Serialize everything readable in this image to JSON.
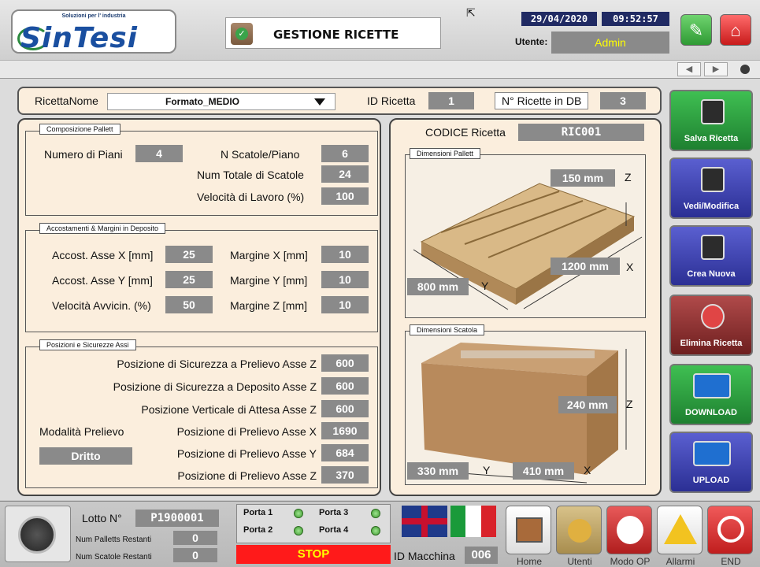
{
  "header": {
    "logo_tagline": "Soluzioni per l' industria",
    "logo_text": "SinTesi",
    "title": "GESTIONE RICETTE",
    "date": "29/04/2020",
    "time": "09:52:57",
    "user_label": "Utente:",
    "user_value": "Admin"
  },
  "navbar": {
    "prev": "◀",
    "next": "▶"
  },
  "recipe_bar": {
    "name_label": "RicettaNome",
    "name_value": "Formato_MEDIO",
    "id_label": "ID Ricetta",
    "id_value": "1",
    "count_label": "N° Ricette in DB",
    "count_value": "3"
  },
  "composition": {
    "title": "Composizione Pallett",
    "floors_label": "Numero di Piani",
    "floors_value": "4",
    "boxes_per_floor_label": "N Scatole/Piano",
    "boxes_per_floor_value": "6",
    "total_boxes_label": "Num Totale di Scatole",
    "total_boxes_value": "24",
    "speed_label": "Velocità di Lavoro (%)",
    "speed_value": "100"
  },
  "approach": {
    "title": "Accostamenti & Margini in Deposito",
    "ax_label": "Accost. Asse X [mm]",
    "ax_value": "25",
    "ay_label": "Accost. Asse Y [mm]",
    "ay_value": "25",
    "av_label": "Velocità Avvicin. (%)",
    "av_value": "50",
    "mx_label": "Margine X [mm]",
    "mx_value": "10",
    "my_label": "Margine Y [mm]",
    "my_value": "10",
    "mz_label": "Margine Z [mm]",
    "mz_value": "10"
  },
  "positions": {
    "title": "Posizioni e Sicurezze Assi",
    "mode_label": "Modalità Prelievo",
    "mode_value": "Dritto",
    "rows": [
      {
        "label": "Posizione di Sicurezza a Prelievo Asse Z",
        "value": "600"
      },
      {
        "label": "Posizione di Sicurezza a Deposito Asse Z",
        "value": "600"
      },
      {
        "label": "Posizione Verticale di Attesa Asse Z",
        "value": "600"
      },
      {
        "label": "Posizione di Prelievo Asse X",
        "value": "1690"
      },
      {
        "label": "Posizione di Prelievo Asse Y",
        "value": "684"
      },
      {
        "label": "Posizione di Prelievo Asse Z",
        "value": "370"
      }
    ]
  },
  "right_panel": {
    "code_label": "CODICE Ricetta",
    "code_value": "RIC001",
    "pallet_title": "Dimensioni Pallett",
    "pallet_z": "150 mm",
    "pallet_z_axis": "Z",
    "pallet_x": "1200 mm",
    "pallet_x_axis": "X",
    "pallet_y": "800 mm",
    "pallet_y_axis": "Y",
    "box_title": "Dimensioni Scatola",
    "box_z": "240 mm",
    "box_z_axis": "Z",
    "box_y": "330 mm",
    "box_y_axis": "Y",
    "box_x": "410 mm",
    "box_x_axis": "X"
  },
  "side_buttons": {
    "save": "Salva Ricetta",
    "edit": "Vedi/Modifica",
    "new": "Crea Nuova",
    "delete": "Elimina Ricetta",
    "download": "DOWNLOAD",
    "upload": "UPLOAD"
  },
  "footer": {
    "lot_label": "Lotto N°",
    "lot_value": "P1900001",
    "pallets_label": "Num Palletts Restanti",
    "pallets_value": "0",
    "boxes_label": "Num Scatole Restanti",
    "boxes_value": "0",
    "doors": [
      "Porta 1",
      "Porta 2",
      "Porta 3",
      "Porta 4"
    ],
    "stop": "STOP",
    "machine_label": "ID Macchina",
    "machine_value": "006",
    "nav": [
      "Home",
      "Utenti",
      "Modo OP",
      "Allarmi",
      "END"
    ]
  },
  "colors": {
    "panel_bg": "#fbeedd",
    "value_bg": "#8a8a8a",
    "date_bg": "#202a63",
    "stop_bg": "#ff1a1a",
    "stop_text": "#ffff00"
  }
}
